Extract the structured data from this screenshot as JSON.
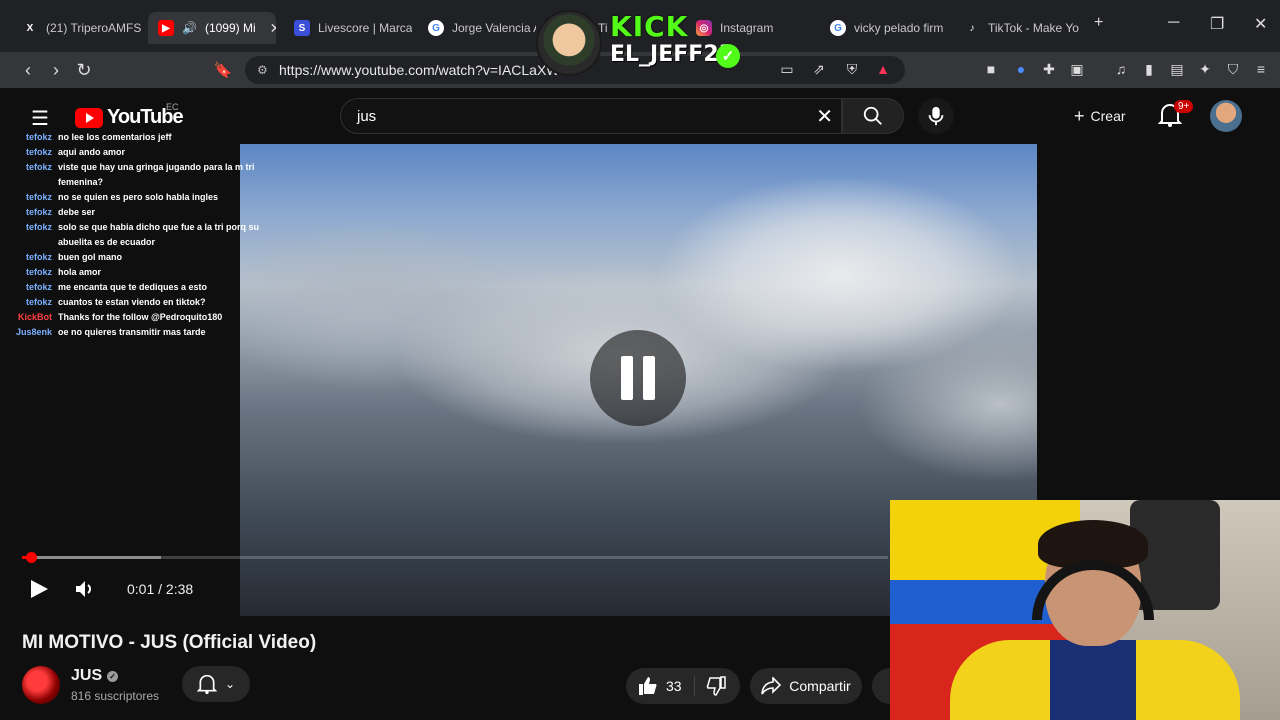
{
  "browser": {
    "tabs": [
      {
        "label": "(21) TriperoAMFS",
        "icon": "x-logo-icon"
      },
      {
        "label": "(1099) Mi",
        "icon": "youtube-icon"
      },
      {
        "label": "Livescore | Marca",
        "icon": "livescore-icon"
      },
      {
        "label": "Jorge Valencia Ar",
        "icon": "google-icon"
      },
      {
        "label": "Ti",
        "icon": "tiktok-icon"
      },
      {
        "label": "Instagram",
        "icon": "instagram-icon"
      },
      {
        "label": "vicky pelado firm",
        "icon": "google-icon"
      },
      {
        "label": "TikTok - Make Yo",
        "icon": "tiktok-icon"
      }
    ],
    "new_tab": "+",
    "url": "https://www.youtube.com/watch?v=IACLaXWt"
  },
  "youtube": {
    "logo_text": "YouTube",
    "country_code": "EC",
    "search_value": "jus",
    "create_label": "Crear",
    "notifications_badge": "9+"
  },
  "chat": [
    {
      "user": "tefokz",
      "msg": "no lee los comentarios jeff"
    },
    {
      "user": "tefokz",
      "msg": "aqui ando amor"
    },
    {
      "user": "tefokz",
      "msg": "viste que hay una gringa jugando para la m tri femenina?"
    },
    {
      "user": "tefokz",
      "msg": "no se quien es pero solo habla ingles"
    },
    {
      "user": "tefokz",
      "msg": "debe ser"
    },
    {
      "user": "tefokz",
      "msg": "solo se que habia dicho que fue a la tri porq su abuelita es de ecuador"
    },
    {
      "user": "tefokz",
      "msg": "buen gol mano"
    },
    {
      "user": "tefokz",
      "msg": "hola amor"
    },
    {
      "user": "tefokz",
      "msg": "me encanta que te dediques a esto"
    },
    {
      "user": "tefokz",
      "msg": "cuantos te estan viendo en tiktok?"
    },
    {
      "user": "KickBot",
      "msg": "Thanks for the follow @Pedroquito180"
    },
    {
      "user": "Jus8enk",
      "msg": "oe no quieres transmitir mas tarde"
    }
  ],
  "player": {
    "time": "0:01 / 2:38",
    "played_fraction": 0.006,
    "buffered_fraction": 0.16
  },
  "video": {
    "title": "MI MOTIVO - JUS (Official Video)",
    "channel": "JUS",
    "subscribers": "816 suscriptores",
    "likes": "33",
    "share_label": "Compartir"
  },
  "overlay": {
    "brand": "KICK",
    "streamer": "EL_JEFF23",
    "brand_color": "#53fc18"
  }
}
